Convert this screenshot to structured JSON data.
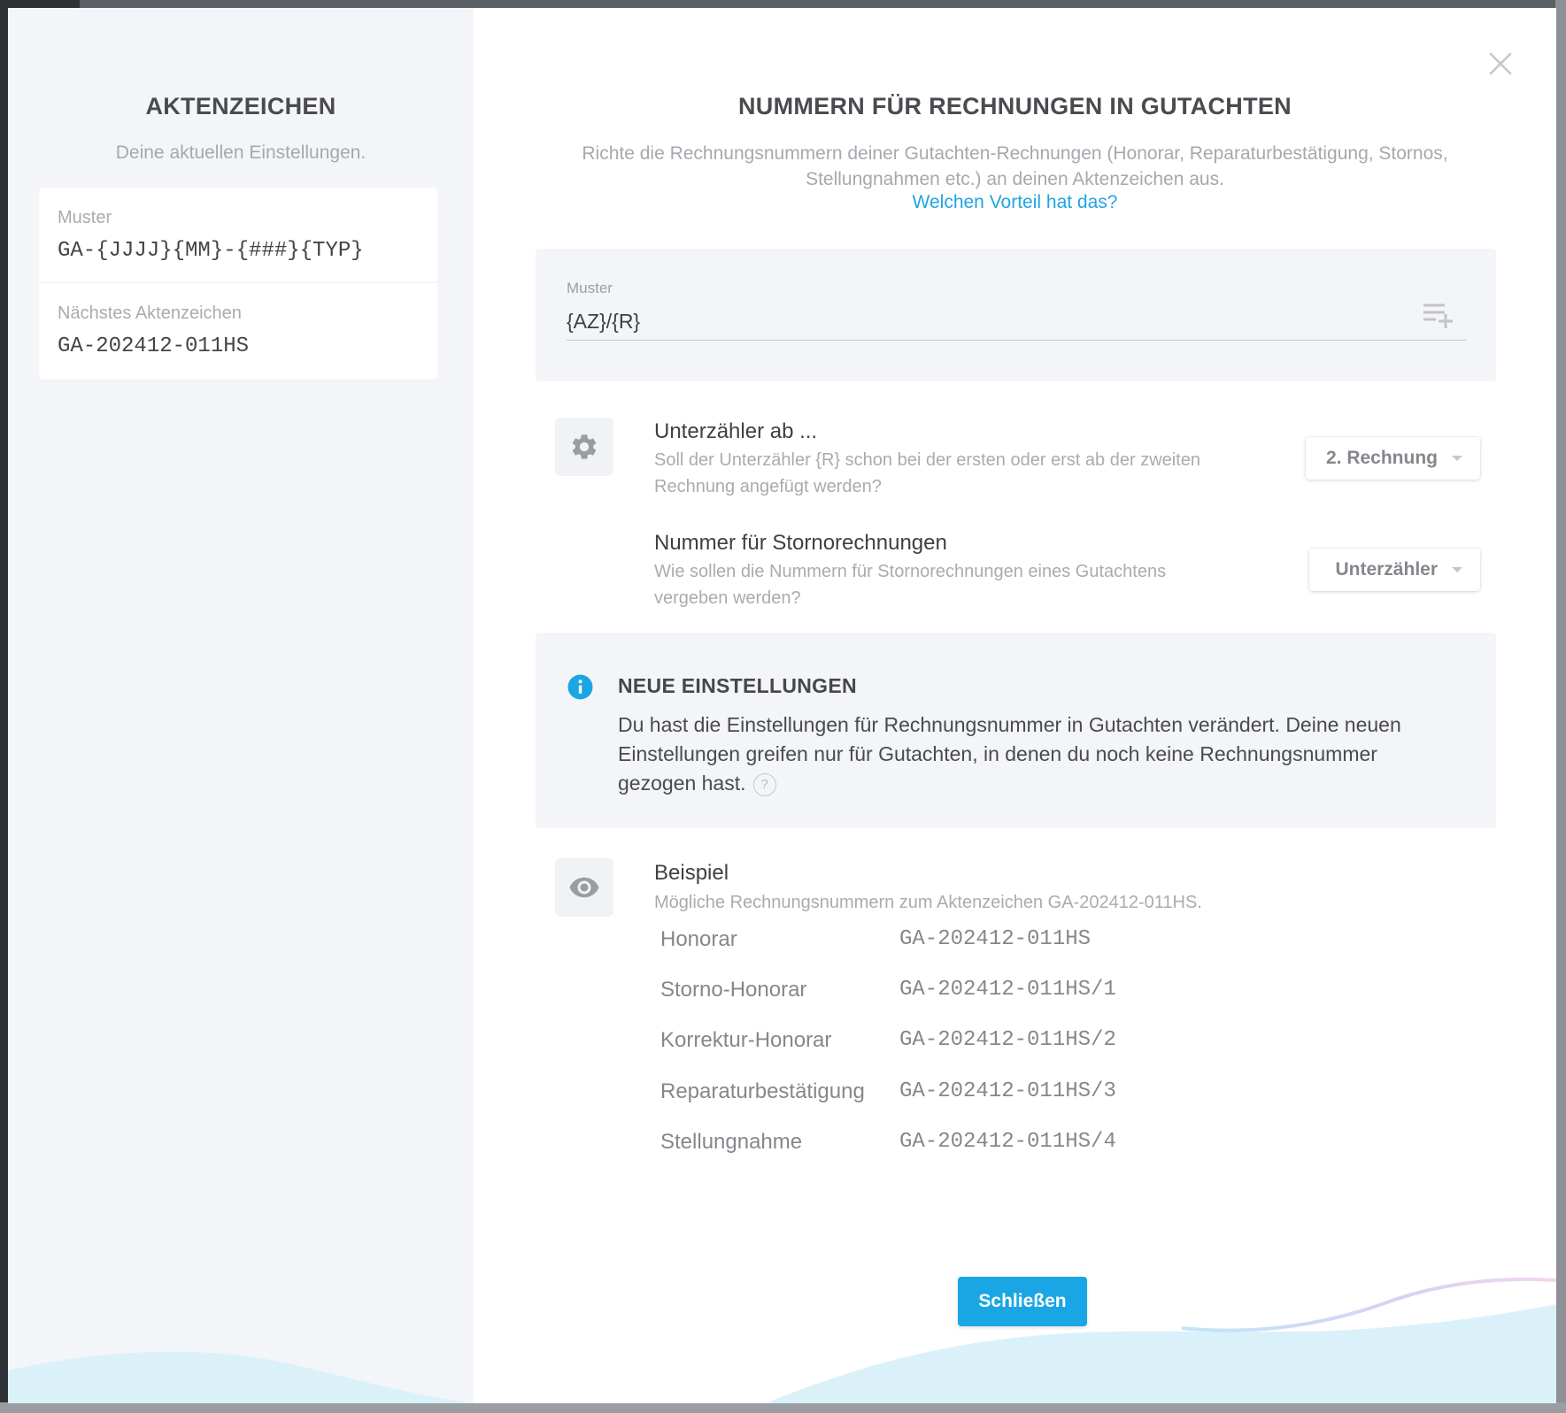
{
  "colors": {
    "accent": "#1aa6e4",
    "link": "#20a4e3",
    "panel_bg": "#f4f5f9",
    "wave": "#dbf1fa"
  },
  "left": {
    "title": "AKTENZEICHEN",
    "subtitle": "Deine aktuellen Einstellungen.",
    "card": {
      "pattern_label": "Muster",
      "pattern_value": "GA-{JJJJ}{MM}-{###}{TYP}",
      "next_label": "Nächstes Aktenzeichen",
      "next_value": "GA-202412-011HS"
    }
  },
  "main": {
    "title": "NUMMERN FÜR RECHNUNGEN IN GUTACHTEN",
    "description_line1": "Richte die Rechnungsnummern deiner Gutachten-Rechnungen (Honorar, Reparaturbestätigung, Stornos,",
    "description_line2": "Stellungnahmen etc.) an deinen Aktenzeichen aus.",
    "advantage_link": "Welchen Vorteil hat das?",
    "pattern": {
      "label": "Muster",
      "value": "{AZ}/{R}",
      "add_icon": "playlist-add-icon"
    },
    "settings": [
      {
        "title": "Unterzähler ab ...",
        "desc_line1": "Soll der Unterzähler {R} schon bei der ersten oder erst ab der zweiten",
        "desc_line2": "Rechnung angefügt werden?",
        "selected": "2. Rechnung",
        "icon": "gear-icon"
      },
      {
        "title": "Nummer für Stornorechnungen",
        "desc_line1": "Wie sollen die Nummern für Stornorechnungen eines Gutachtens",
        "desc_line2": "vergeben werden?",
        "selected": "Unterzähler"
      }
    ],
    "info": {
      "icon": "info-icon",
      "title": "NEUE EINSTELLUNGEN",
      "text_line1": "Du hast die Einstellungen für Rechnungsnummer in Gutachten verändert. Deine neuen",
      "text_line2": "Einstellungen greifen nur für Gutachten, in denen du noch keine Rechnungsnummer",
      "text_line3": "gezogen hast.",
      "help": "?"
    },
    "example": {
      "icon": "eye-icon",
      "title": "Beispiel",
      "subtitle": "Mögliche Rechnungsnummern zum Aktenzeichen GA-202412-011HS.",
      "rows": [
        {
          "label": "Honorar",
          "value": "GA-202412-011HS"
        },
        {
          "label": "Storno-Honorar",
          "value": "GA-202412-011HS/1"
        },
        {
          "label": "Korrektur-Honorar",
          "value": "GA-202412-011HS/2"
        },
        {
          "label": "Reparaturbestätigung",
          "value": "GA-202412-011HS/3"
        },
        {
          "label": "Stellungnahme",
          "value": "GA-202412-011HS/4"
        }
      ]
    },
    "close_button": "Schließen",
    "close_icon": "close-icon"
  }
}
